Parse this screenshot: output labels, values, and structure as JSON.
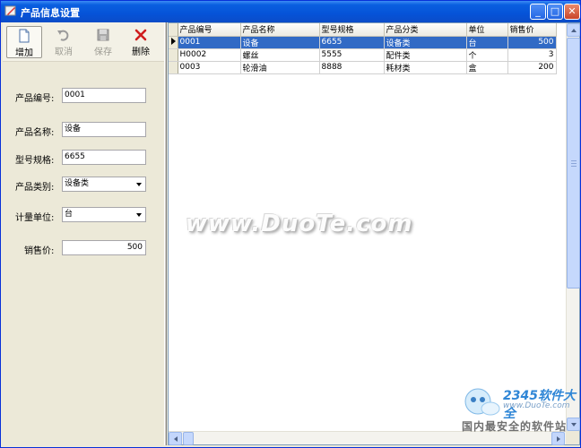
{
  "window": {
    "title": "产品信息设置",
    "controls": {
      "minimize": "_",
      "maximize": "□",
      "close": "✕"
    }
  },
  "toolbar": {
    "add_label": "增加",
    "cancel_label": "取消",
    "save_label": "保存",
    "delete_label": "删除"
  },
  "form": {
    "code_label": "产品编号:",
    "code_value": "0001",
    "name_label": "产品名称:",
    "name_value": "设备",
    "model_label": "型号规格:",
    "model_value": "6655",
    "category_label": "产品类别:",
    "category_value": "设备类",
    "unit_label": "计量单位:",
    "unit_value": "台",
    "price_label": "销售价:",
    "price_value": "500"
  },
  "grid": {
    "columns": [
      "产品编号",
      "产品名称",
      "型号规格",
      "产品分类",
      "单位",
      "销售价"
    ],
    "rows": [
      [
        "0001",
        "设备",
        "6655",
        "设备类",
        "台",
        "500"
      ],
      [
        "H0002",
        "螺丝",
        "5555",
        "配件类",
        "个",
        "3"
      ],
      [
        "0003",
        "轮滑油",
        "8888",
        "耗材类",
        "盒",
        "200"
      ]
    ],
    "selected_row": 0
  },
  "watermark": {
    "main": "www.DuoTe.com",
    "brand": "2345软件大全",
    "url": "www.DuoTe.com",
    "slogan": "国内最安全的软件站"
  },
  "colors": {
    "titlebar": "#0553d8",
    "selection": "#316ac5",
    "panel": "#ece9d8"
  }
}
